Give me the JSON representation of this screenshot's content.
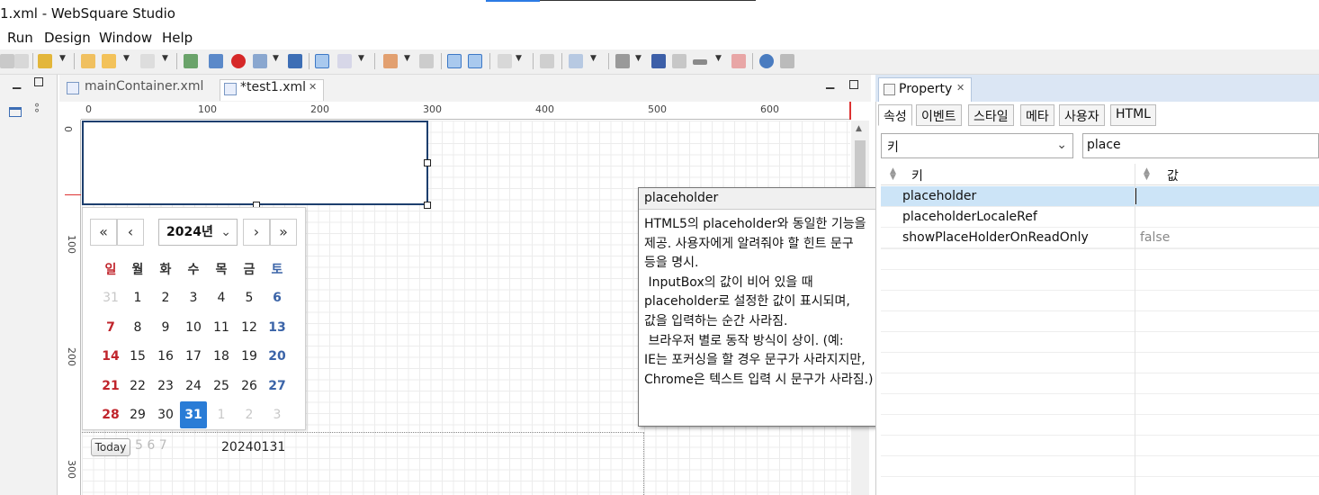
{
  "window": {
    "title": "1.xml - WebSquare Studio"
  },
  "menu": {
    "items": [
      "Run",
      "Design",
      "Window",
      "Help"
    ]
  },
  "editor": {
    "tabs": [
      {
        "label": "mainContainer.xml",
        "active": false
      },
      {
        "label": "*test1.xml",
        "active": true
      }
    ],
    "ruler_top": [
      "0",
      "100",
      "200",
      "300",
      "400",
      "500",
      "600"
    ],
    "ruler_left": [
      "0",
      "100",
      "200",
      "300"
    ]
  },
  "calendar": {
    "year": "2024년",
    "nav": {
      "first": "«",
      "prev": "‹",
      "next": "›",
      "last": "»"
    },
    "weekdays": [
      "일",
      "월",
      "화",
      "수",
      "목",
      "금",
      "토"
    ],
    "weeks": [
      [
        "31",
        "1",
        "2",
        "3",
        "4",
        "5",
        "6"
      ],
      [
        "7",
        "8",
        "9",
        "10",
        "11",
        "12",
        "13"
      ],
      [
        "14",
        "15",
        "16",
        "17",
        "18",
        "19",
        "20"
      ],
      [
        "21",
        "22",
        "23",
        "24",
        "25",
        "26",
        "27"
      ],
      [
        "28",
        "29",
        "30",
        "31",
        "1",
        "2",
        "3"
      ]
    ],
    "selected": "31",
    "today_label": "Today",
    "underlay": "5  6  7",
    "value": "20240131"
  },
  "tooltip": {
    "title": "placeholder",
    "body": "HTML5의 placeholder와 동일한 기능을\n제공. 사용자에게 알려줘야 할 힌트 문구\n등을 명시.\n InputBox의 값이 비어 있을 때\nplaceholder로 설정한 값이 표시되며,\n값을 입력하는 순간 사라짐.\n 브라우저 별로 동작 방식이 상이. (예:\nIE는 포커싱을 할 경우 문구가 사라지지만,\nChrome은 텍스트 입력 시 문구가 사라짐.)"
  },
  "property": {
    "panel_title": "Property",
    "tabs": [
      "속성",
      "이벤트",
      "스타일",
      "메타",
      "사용자",
      "HTML"
    ],
    "key_select": "키",
    "search_value": "place",
    "columns": {
      "key": "키",
      "value": "값"
    },
    "rows": [
      {
        "key": "placeholder",
        "value": ""
      },
      {
        "key": "placeholderLocaleRef",
        "value": ""
      },
      {
        "key": "showPlaceHolderOnReadOnly",
        "value": "false"
      }
    ]
  },
  "colors": {
    "accent": "#2a7cd6",
    "sunday": "#c0242b",
    "saturday": "#3b64a8",
    "selection_row": "#cce4f7"
  }
}
